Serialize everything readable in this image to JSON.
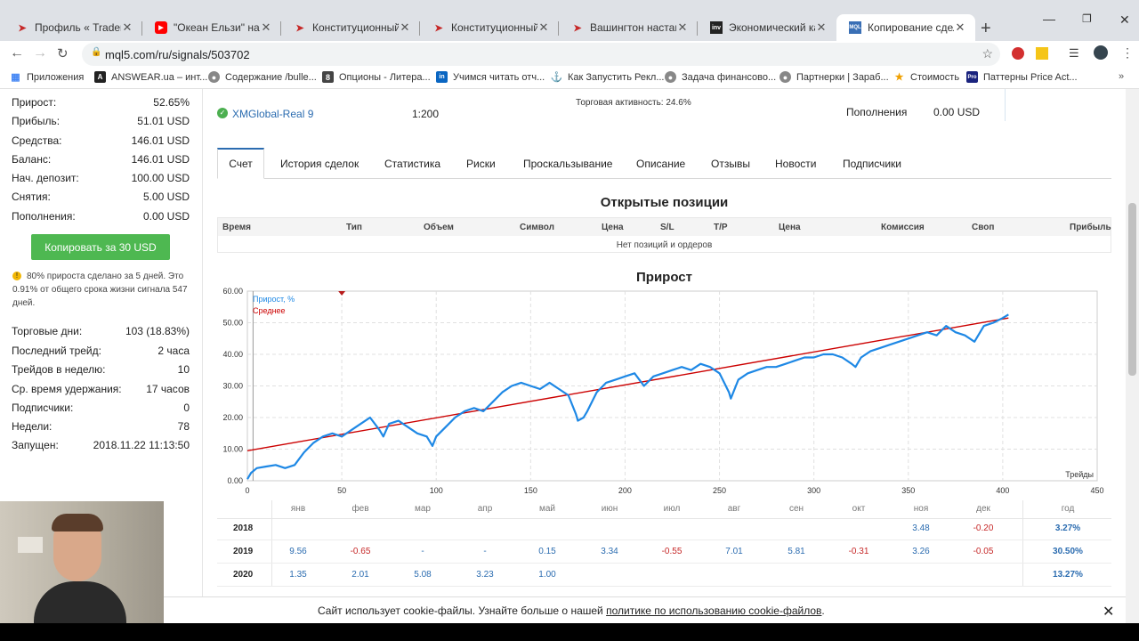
{
  "browser": {
    "tabs": [
      {
        "title": "Профиль « Trader Assi",
        "icon": "red-play-icon"
      },
      {
        "title": "\"Океан Ельзи\" на \"НАШ",
        "icon": "youtube-icon"
      },
      {
        "title": "Конституционный суд",
        "icon": "red-play-icon"
      },
      {
        "title": "Конституционный суд",
        "icon": "red-play-icon"
      },
      {
        "title": "Вашингтон настаивае",
        "icon": "red-play-icon"
      },
      {
        "title": "Экономический кален",
        "icon": "investing-icon"
      },
      {
        "title": "Копирование сделок",
        "icon": "mql5-icon"
      }
    ],
    "url": "mql5.com/ru/signals/503702",
    "bookmarks": [
      "Приложения",
      "ANSWEAR.ua – инт...",
      "Содержание /bulle...",
      "Опционы - Литера...",
      "Учимся читать отч...",
      "Как Запустить Рекл...",
      "Задача финансово...",
      "Партнерки | Зараб...",
      "Стоимость",
      "Паттерны Price Act..."
    ],
    "colors": {
      "tabbar": "#dee1e6",
      "accent": "#2b6cb0"
    }
  },
  "sidebar": {
    "stats": [
      {
        "label": "Прирост:",
        "value": "52.65%"
      },
      {
        "label": "Прибыль:",
        "value": "51.01 USD"
      },
      {
        "label": "Средства:",
        "value": "146.01 USD"
      },
      {
        "label": "Баланс:",
        "value": "146.01 USD"
      },
      {
        "label": "Нач. депозит:",
        "value": "100.00 USD"
      },
      {
        "label": "Снятия:",
        "value": "5.00 USD"
      },
      {
        "label": "Пополнения:",
        "value": "0.00 USD"
      }
    ],
    "copy_button": "Копировать за 30 USD",
    "note": "80% прироста сделано за 5 дней. Это 0.91% от общего срока жизни сигнала 547 дней.",
    "info": [
      {
        "label": "Торговые дни:",
        "value": "103 (18.83%)"
      },
      {
        "label": "Последний трейд:",
        "value": "2 часа"
      },
      {
        "label": "Трейдов в неделю:",
        "value": "10"
      },
      {
        "label": "Ср. время удержания:",
        "value": "17 часов"
      },
      {
        "label": "Подписчики:",
        "value": "0"
      },
      {
        "label": "Недели:",
        "value": "78"
      },
      {
        "label": "Запущен:",
        "value": "2018.11.22 11:13:50"
      }
    ]
  },
  "account": {
    "broker": "XMGlobal-Real 9",
    "leverage": "1:200",
    "activity": "Торговая активность: 24.6%",
    "deposits_label": "Пополнения",
    "deposits_value": "0.00 USD"
  },
  "page_tabs": [
    "Счет",
    "История сделок",
    "Статистика",
    "Риски",
    "Проскальзывание",
    "Описание",
    "Отзывы",
    "Новости",
    "Подписчики"
  ],
  "positions": {
    "title": "Открытые позиции",
    "columns": [
      "Время",
      "Тип",
      "Объем",
      "Символ",
      "Цена",
      "S/L",
      "T/P",
      "Цена",
      "Комиссия",
      "Своп",
      "Прибыль"
    ],
    "empty": "Нет позиций и ордеров"
  },
  "chart_data": {
    "type": "line",
    "title": "Прирост",
    "xlabel": "Трейды",
    "xlim": [
      0,
      450
    ],
    "ylim": [
      0,
      60
    ],
    "xticks": [
      "0",
      "50",
      "100",
      "150",
      "200",
      "250",
      "300",
      "350",
      "400",
      "450"
    ],
    "yticks": [
      "0.00",
      "10.00",
      "20.00",
      "30.00",
      "40.00",
      "50.00",
      "60.00"
    ],
    "grid": true,
    "legend_position": "top-left",
    "series": [
      {
        "name": "Прирост, %",
        "color": "#1e88e5",
        "x": [
          0,
          2,
          5,
          10,
          15,
          20,
          25,
          30,
          35,
          40,
          45,
          50,
          55,
          60,
          65,
          70,
          72,
          75,
          80,
          85,
          90,
          95,
          98,
          100,
          105,
          110,
          115,
          120,
          125,
          130,
          135,
          140,
          145,
          150,
          155,
          160,
          165,
          170,
          174,
          175,
          178,
          180,
          185,
          190,
          195,
          200,
          205,
          210,
          215,
          220,
          225,
          230,
          235,
          240,
          245,
          250,
          255,
          256,
          260,
          265,
          270,
          275,
          280,
          285,
          290,
          295,
          300,
          305,
          310,
          315,
          320,
          322,
          325,
          330,
          335,
          340,
          345,
          350,
          355,
          360,
          365,
          370,
          375,
          380,
          385,
          390,
          395,
          400,
          403
        ],
        "y": [
          0.5,
          2.5,
          4,
          4.5,
          5,
          4,
          5,
          9,
          12,
          14,
          15,
          14,
          16,
          18,
          20,
          16,
          14,
          18,
          19,
          17,
          15,
          14,
          11,
          14,
          17,
          20,
          22,
          23,
          22,
          25,
          28,
          30,
          31,
          30,
          29,
          31,
          29,
          27,
          21,
          19,
          20,
          22,
          28,
          31,
          32,
          33,
          34,
          30,
          33,
          34,
          35,
          36,
          35,
          37,
          36,
          34,
          28,
          26,
          32,
          34,
          35,
          36,
          36,
          37,
          38,
          39,
          39,
          40,
          40,
          39,
          37,
          36,
          39,
          41,
          42,
          43,
          44,
          45,
          46,
          47,
          46,
          49,
          47,
          46,
          44,
          49,
          50,
          51.5,
          52.6
        ]
      },
      {
        "name": "Среднее",
        "color": "#cc0000",
        "x": [
          0,
          403
        ],
        "y": [
          9.5,
          51.5
        ]
      }
    ]
  },
  "yearly": {
    "months": [
      "янв",
      "фев",
      "мар",
      "апр",
      "май",
      "июн",
      "июл",
      "авг",
      "сен",
      "окт",
      "ноя",
      "дек"
    ],
    "total_header": "год",
    "rows": [
      {
        "year": "2018",
        "values": [
          "",
          "",
          "",
          "",
          "",
          "",
          "",
          "",
          "",
          "",
          "3.48",
          "-0.20"
        ],
        "total": "3.27%"
      },
      {
        "year": "2019",
        "values": [
          "9.56",
          "-0.65",
          "-",
          "-",
          "0.15",
          "3.34",
          "-0.55",
          "7.01",
          "5.81",
          "-0.31",
          "3.26",
          "-0.05"
        ],
        "total": "30.50%"
      },
      {
        "year": "2020",
        "values": [
          "1.35",
          "2.01",
          "5.08",
          "3.23",
          "1.00",
          "",
          "",
          "",
          "",
          "",
          "",
          ""
        ],
        "total": "13.27%"
      }
    ]
  },
  "cookie": {
    "text": "Сайт использует cookie-файлы. Узнайте больше о нашей ",
    "link": "политике по использованию cookie-файлов",
    "end": "."
  }
}
